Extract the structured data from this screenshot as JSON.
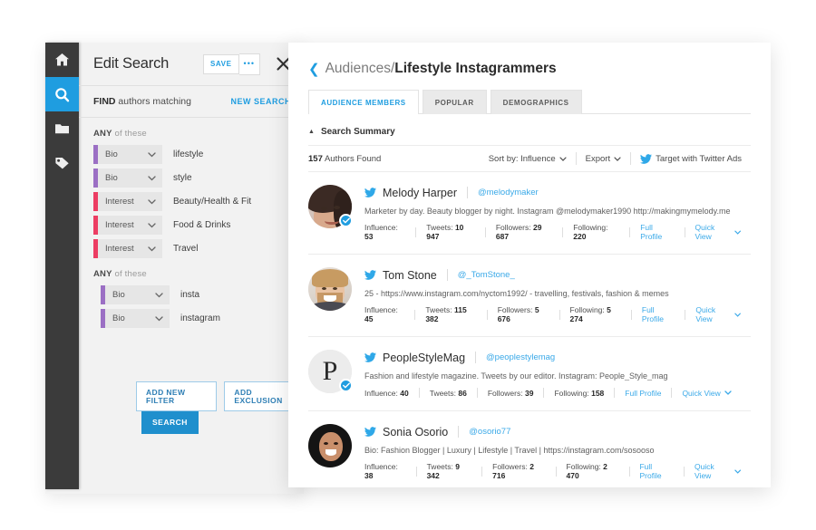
{
  "rail": {
    "items": [
      {
        "icon": "home-icon",
        "active": false
      },
      {
        "icon": "search-icon",
        "active": true
      },
      {
        "icon": "folder-icon",
        "active": false
      },
      {
        "icon": "tag-icon",
        "active": false
      }
    ],
    "background": "#3b3b3b",
    "active_color": "#1f9de0"
  },
  "edit_search": {
    "title": "Edit Search",
    "save_label": "SAVE",
    "more_label": "•••",
    "close_label": "×",
    "find_prefix": "FIND",
    "find_text": " authors matching",
    "new_search_label": "NEW SEARCH",
    "groups": [
      {
        "label_bold": "ANY",
        "label_rest": " of these",
        "rows": [
          {
            "field": "Bio",
            "value": "lifestyle",
            "bar_color": "#9b6fc4"
          },
          {
            "field": "Bio",
            "value": "style",
            "bar_color": "#9b6fc4"
          },
          {
            "field": "Interest",
            "value": "Beauty/Health & Fit",
            "bar_color": "#ec3d63"
          },
          {
            "field": "Interest",
            "value": "Food & Drinks",
            "bar_color": "#ec3d63"
          },
          {
            "field": "Interest",
            "value": "Travel",
            "bar_color": "#ec3d63"
          }
        ]
      },
      {
        "label_bold": "ANY",
        "label_rest": " of these",
        "rows": [
          {
            "field": "Bio",
            "value": "insta",
            "bar_color": "#9b6fc4"
          },
          {
            "field": "Bio",
            "value": "instagram",
            "bar_color": "#9b6fc4"
          }
        ]
      }
    ],
    "add_filter_label": "ADD NEW FILTER",
    "add_exclusion_label": "ADD EXCLUSION",
    "search_label": "SEARCH"
  },
  "breadcrumb": {
    "back_icon": "chevron-left-icon",
    "parent": "Audiences",
    "separator": "/",
    "current": "Lifestyle Instagrammers"
  },
  "tabs": [
    {
      "label": "AUDIENCE MEMBERS",
      "active": true
    },
    {
      "label": "POPULAR",
      "active": false
    },
    {
      "label": "DEMOGRAPHICS",
      "active": false
    }
  ],
  "summary": {
    "caret": "▲",
    "label": "Search Summary"
  },
  "toolbar": {
    "count": "157",
    "count_suffix": " Authors Found",
    "sort_label": "Sort by: Influence",
    "export_label": "Export",
    "twitter_ads_label": "Target with Twitter Ads"
  },
  "stat_labels": {
    "influence": "Influence:",
    "tweets": "Tweets:",
    "followers": "Followers:",
    "following": "Following:",
    "full_profile": "Full Profile",
    "quick_view": "Quick View"
  },
  "results": [
    {
      "name": "Melody Harper",
      "handle": "@melodymaker",
      "bio": "Marketer by day. Beauty blogger by night. Instagram @melodymaker1990 http://makingmymelody.me",
      "influence": "53",
      "tweets": "10 947",
      "followers": "29 687",
      "following": "220",
      "verified": true,
      "avatar": "photo-melody-harper"
    },
    {
      "name": "Tom Stone",
      "handle": "@_TomStone_",
      "bio": "25 - https://www.instagram.com/nyctom1992/ - travelling, festivals, fashion & memes",
      "influence": "45",
      "tweets": "115 382",
      "followers": "5 676",
      "following": "5 274",
      "verified": false,
      "avatar": "photo-tom-stone"
    },
    {
      "name": "PeopleStyleMag",
      "handle": "@peoplestylemag",
      "bio": "Fashion and lifestyle magazine. Tweets by our editor. Instagram: People_Style_mag",
      "influence": "40",
      "tweets": "86",
      "followers": "39",
      "following": "158",
      "verified": true,
      "avatar": "logo-people-style-mag"
    },
    {
      "name": "Sonia Osorio",
      "handle": "@osorio77",
      "bio": "Bio: Fashion Blogger | Luxury | Lifestyle | Travel | https://instagram.com/sosooso",
      "influence": "38",
      "tweets": "9 342",
      "followers": "2 716",
      "following": "2 470",
      "verified": false,
      "avatar": "photo-sonia-osorio"
    }
  ],
  "colors": {
    "accent": "#1f9de0",
    "link": "#3aa9e8",
    "purple_bar": "#9b6fc4",
    "pink_bar": "#ec3d63",
    "rail_dark": "#3b3b3b",
    "panel_gray": "#f2f2f2"
  }
}
